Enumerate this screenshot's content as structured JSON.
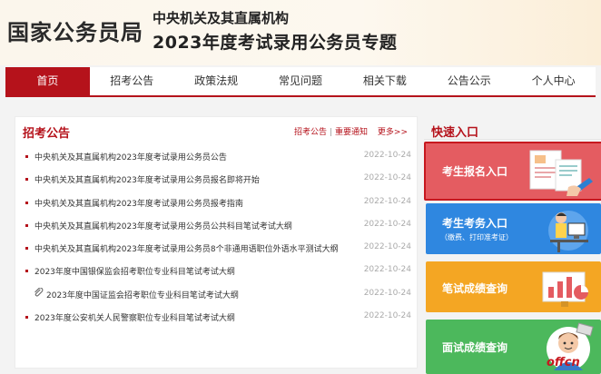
{
  "header": {
    "site_title": "国家公务员局",
    "line1": "中央机关及其直属机构",
    "line2": "2023年度考试录用公务员专题"
  },
  "nav": [
    "首页",
    "招考公告",
    "政策法规",
    "常见问题",
    "相关下载",
    "公告公示",
    "个人中心"
  ],
  "news_panel": {
    "title": "招考公告",
    "links": [
      "招考公告",
      "重要通知",
      "更多>>"
    ],
    "items": [
      {
        "title": "中央机关及其直属机构2023年度考试录用公务员公告",
        "date": "2022-10-24"
      },
      {
        "title": "中央机关及其直属机构2023年度考试录用公务员报名即将开始",
        "date": "2022-10-24"
      },
      {
        "title": "中央机关及其直属机构2023年度考试录用公务员报考指南",
        "date": "2022-10-24"
      },
      {
        "title": "中央机关及其直属机构2023年度考试录用公务员公共科目笔试考试大纲",
        "date": "2022-10-24"
      },
      {
        "title": "中央机关及其直属机构2023年度考试录用公务员8个非通用语职位外语水平测试大纲",
        "date": "2022-10-24"
      },
      {
        "title": "2023年度中国银保监会招考职位专业科目笔试考试大纲",
        "date": "2022-10-24"
      },
      {
        "title": "2023年度中国证监会招考职位专业科目笔试考试大纲",
        "date": "2022-10-24"
      },
      {
        "title": "2023年度公安机关人民警察职位专业科目笔试考试大纲",
        "date": "2022-10-24"
      }
    ]
  },
  "quick": {
    "title": "快速入口",
    "buttons": [
      {
        "label": "考生报名入口"
      },
      {
        "label": "考生考务入口",
        "sub": "（缴费、打印准考证）"
      },
      {
        "label": "笔试成绩查询"
      },
      {
        "label": "面试成绩查询"
      }
    ]
  },
  "brand": "offcn",
  "colors": {
    "accent": "#b5121b",
    "q1": "#e45c61",
    "q2": "#2f87e0",
    "q3": "#f4a623",
    "q4": "#4cb85c"
  },
  "icons": [
    "paperclip-icon",
    "registration-form-illustration",
    "candidate-at-computer-illustration",
    "score-chart-illustration",
    "interview-person-illustration"
  ]
}
